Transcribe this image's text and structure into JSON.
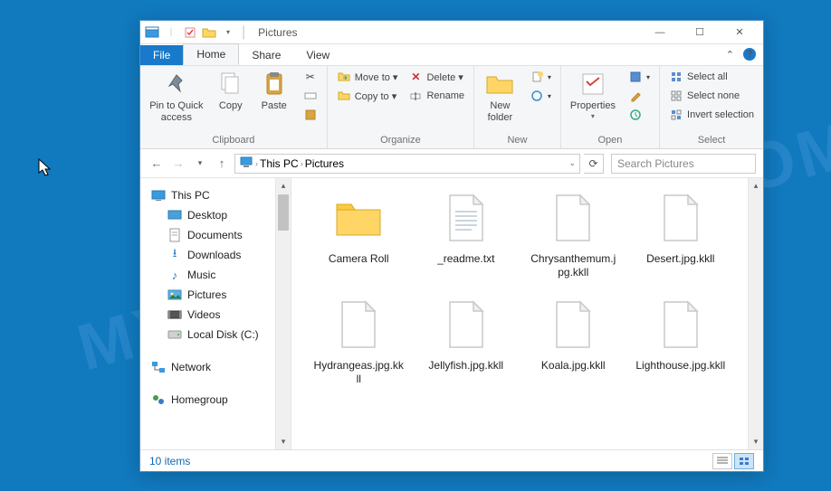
{
  "window": {
    "title": "Pictures",
    "controls": {
      "min": "—",
      "max": "☐",
      "close": "✕"
    }
  },
  "tabs": {
    "file": "File",
    "home": "Home",
    "share": "Share",
    "view": "View",
    "collapse": "⌃"
  },
  "ribbon": {
    "clipboard": {
      "label": "Clipboard",
      "pin": "Pin to Quick access",
      "copy": "Copy",
      "paste": "Paste"
    },
    "organize": {
      "label": "Organize",
      "moveto": "Move to ▾",
      "copyto": "Copy to ▾",
      "delete": "Delete ▾",
      "rename": "Rename"
    },
    "new": {
      "label": "New",
      "newfolder": "New folder"
    },
    "open": {
      "label": "Open",
      "properties": "Properties"
    },
    "select": {
      "label": "Select",
      "selectall": "Select all",
      "selectnone": "Select none",
      "invert": "Invert selection"
    }
  },
  "addr": {
    "crumb1": "This PC",
    "crumb2": "Pictures",
    "search_placeholder": "Search Pictures"
  },
  "nav": {
    "thispc": "This PC",
    "desktop": "Desktop",
    "documents": "Documents",
    "downloads": "Downloads",
    "music": "Music",
    "pictures": "Pictures",
    "videos": "Videos",
    "localdisk": "Local Disk (C:)",
    "network": "Network",
    "homegroup": "Homegroup"
  },
  "items": [
    {
      "name": "Camera Roll",
      "type": "folder"
    },
    {
      "name": "_readme.txt",
      "type": "text"
    },
    {
      "name": "Chrysanthemum.jpg.kkll",
      "type": "file"
    },
    {
      "name": "Desert.jpg.kkll",
      "type": "file"
    },
    {
      "name": "Hydrangeas.jpg.kkll",
      "type": "file"
    },
    {
      "name": "Jellyfish.jpg.kkll",
      "type": "file"
    },
    {
      "name": "Koala.jpg.kkll",
      "type": "file"
    },
    {
      "name": "Lighthouse.jpg.kkll",
      "type": "file"
    }
  ],
  "status": {
    "count": "10 items"
  },
  "watermark": "MYANTISPYWARE.COM"
}
